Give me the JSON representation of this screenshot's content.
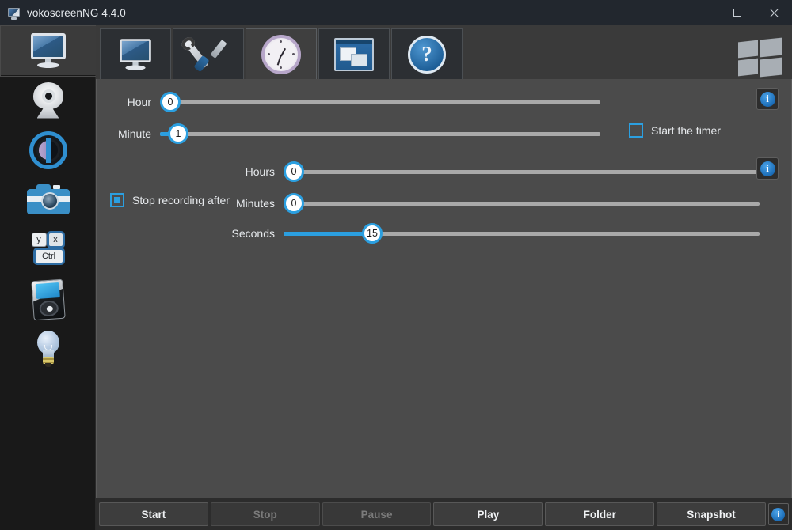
{
  "window": {
    "title": "vokoscreenNG 4.4.0",
    "icon": "app-screen-icon",
    "controls": {
      "minimize": "minimize",
      "maximize": "maximize",
      "close": "close"
    }
  },
  "sidebar": {
    "items": [
      {
        "name": "screen",
        "icon": "monitor-icon",
        "selected": true
      },
      {
        "name": "webcam",
        "icon": "webcam-icon",
        "selected": false
      },
      {
        "name": "magnifier",
        "icon": "magnifier-lens-icon",
        "selected": false
      },
      {
        "name": "camera",
        "icon": "photo-camera-icon",
        "selected": false
      },
      {
        "name": "hotkeys",
        "icon": "keyboard-keys-icon",
        "selected": false
      },
      {
        "name": "player",
        "icon": "media-player-icon",
        "selected": false
      },
      {
        "name": "tips",
        "icon": "lightbulb-icon",
        "selected": false
      }
    ],
    "keys": {
      "key1": "y",
      "key2": "x",
      "key3": "Ctrl"
    }
  },
  "tabs": [
    {
      "name": "tab-screen",
      "icon": "monitor-icon",
      "active": false
    },
    {
      "name": "tab-tools",
      "icon": "tools-icon",
      "active": false
    },
    {
      "name": "tab-timer",
      "icon": "clock-icon",
      "active": true
    },
    {
      "name": "tab-windows",
      "icon": "windows-overlap-icon",
      "active": false
    },
    {
      "name": "tab-help",
      "icon": "question-mark-icon",
      "active": false
    }
  ],
  "tab_corner_logo": "windows-logo-icon",
  "timer": {
    "start_group": {
      "hour": {
        "label": "Hour",
        "value": "0",
        "percent": 0
      },
      "minute": {
        "label": "Minute",
        "value": "1",
        "percent": 2
      },
      "checkbox": {
        "label": "Start the timer",
        "checked": false
      },
      "info": "i"
    },
    "stop_group": {
      "checkbox": {
        "label": "Stop recording after",
        "checked": true
      },
      "hours": {
        "label": "Hours",
        "value": "0",
        "percent": 0
      },
      "minutes": {
        "label": "Minutes",
        "value": "0",
        "percent": 0
      },
      "seconds": {
        "label": "Seconds",
        "value": "15",
        "percent": 17
      },
      "info": "i"
    }
  },
  "bottom_buttons": [
    {
      "label": "Start",
      "disabled": false
    },
    {
      "label": "Stop",
      "disabled": true
    },
    {
      "label": "Pause",
      "disabled": true
    },
    {
      "label": "Play",
      "disabled": false
    },
    {
      "label": "Folder",
      "disabled": false
    },
    {
      "label": "Snapshot",
      "disabled": false
    }
  ],
  "bottom_info": "i",
  "colors": {
    "accent": "#2b9fe0",
    "titlebar_bg": "#22272e",
    "sidebar_bg": "#191919",
    "tabbar_bg": "#3a3a3a",
    "content_bg": "#4b4b4b",
    "bottombar_bg": "#2c2c2c"
  }
}
